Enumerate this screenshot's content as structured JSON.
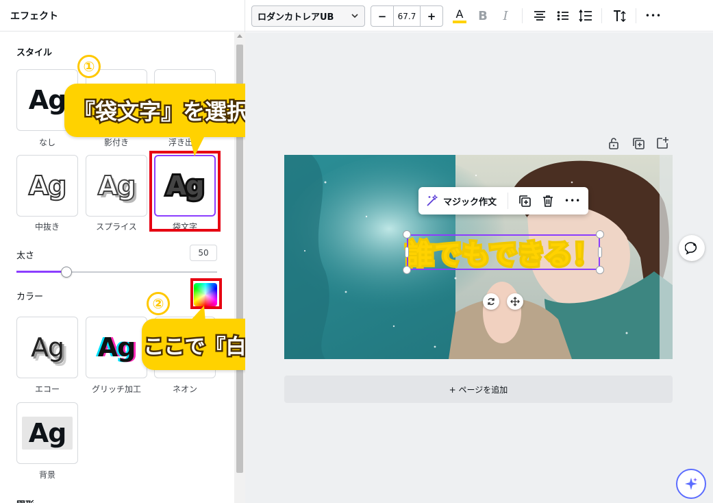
{
  "panel": {
    "title": "エフェクト",
    "style_section": "スタイル",
    "tile_sample": "Ag",
    "styles": [
      {
        "label": "なし"
      },
      {
        "label": "影付き"
      },
      {
        "label": "浮き出し"
      },
      {
        "label": "中抜き"
      },
      {
        "label": "スプライス"
      },
      {
        "label": "袋文字",
        "selected": true
      },
      {
        "label": "エコー"
      },
      {
        "label": "グリッチ加工"
      },
      {
        "label": "ネオン"
      },
      {
        "label": "背景"
      }
    ],
    "thickness_label": "太さ",
    "thickness_value": "50",
    "thickness_level": 0.25,
    "color_label": "カラー",
    "next_section": "図形"
  },
  "annotations": {
    "step1_number": "①",
    "step1_text": "『袋文字』を選択",
    "step2_number": "②",
    "step2_text": "ここで『白』を選択",
    "highlight_color": "#e60012",
    "bubble_color": "#ffd200"
  },
  "toolbar": {
    "font_name": "ロダンカトレアUB",
    "size_minus": "−",
    "font_size": "67.7",
    "size_plus": "+",
    "text_color_glyph": "A",
    "bold_glyph": "B",
    "italic_glyph": "I",
    "more_glyph": "•••"
  },
  "canvas": {
    "design_text": "誰でもできる！",
    "magic_write": "マジック作文",
    "add_page": "+ ページを追加",
    "accent_color": "#8b3dff"
  }
}
